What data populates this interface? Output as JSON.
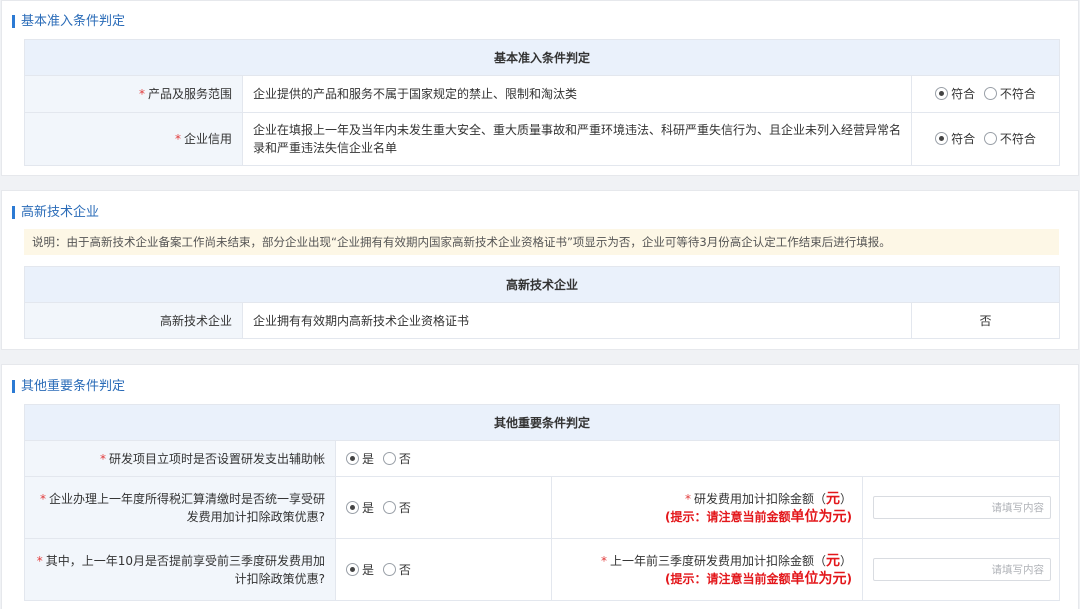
{
  "section1": {
    "title": "基本准入条件判定",
    "table_header": "基本准入条件判定",
    "rows": [
      {
        "label": "产品及服务范围",
        "content": "企业提供的产品和服务不属于国家规定的禁止、限制和淘汰类",
        "opt_yes": "符合",
        "opt_no": "不符合",
        "selected": "符合"
      },
      {
        "label": "企业信用",
        "content": "企业在填报上一年及当年内未发生重大安全、重大质量事故和严重环境违法、科研严重失信行为、且企业未列入经营异常名录和严重违法失信企业名单",
        "opt_yes": "符合",
        "opt_no": "不符合",
        "selected": "符合"
      }
    ]
  },
  "section2": {
    "title": "高新技术企业",
    "notice": "说明：由于高新技术企业备案工作尚未结束，部分企业出现“企业拥有有效期内国家高新技术企业资格证书”项显示为否，企业可等待3月份高企认定工作结束后进行填报。",
    "table_header": "高新技术企业",
    "row": {
      "label": "高新技术企业",
      "content": "企业拥有有效期内高新技术企业资格证书",
      "value": "否"
    }
  },
  "section3": {
    "title": "其他重要条件判定",
    "table_header": "其他重要条件判定",
    "row1": {
      "label": "研发项目立项时是否设置研发支出辅助帐",
      "opt_yes": "是",
      "opt_no": "否",
      "selected": "是"
    },
    "row2": {
      "label_line1": "企业办理上一年度所得税汇算清缴时是否统一享受研",
      "label_line2": "发费用加计扣除政策优惠?",
      "opt_yes": "是",
      "opt_no": "否",
      "selected": "是",
      "amount_label": "研发费用加计扣除金额",
      "unit_open": "（",
      "unit": "元",
      "unit_close": "）",
      "hint_prefix": "(提示：请注意当前金额",
      "hint_big": "单位为元",
      "hint_suffix": ")",
      "placeholder": "请填写内容"
    },
    "row3": {
      "label_line1": "其中，上一年10月是否提前享受前三季度研发费用加",
      "label_line2": "计扣除政策优惠?",
      "opt_yes": "是",
      "opt_no": "否",
      "selected": "是",
      "amount_label": "上一年前三季度研发费用加计扣除金额",
      "unit_open": "（",
      "unit": "元",
      "unit_close": "）",
      "hint_prefix": "(提示：请注意当前金额",
      "hint_big": "单位为元",
      "hint_suffix": ")",
      "placeholder": "请填写内容"
    }
  },
  "colors": {
    "accent": "#2b6cb8",
    "header_bg": "#eaf1fb",
    "label_bg": "#f2f6fb",
    "notice_bg": "#fdf7e6",
    "hint": "#e3171b",
    "required": "#e23b3b"
  }
}
